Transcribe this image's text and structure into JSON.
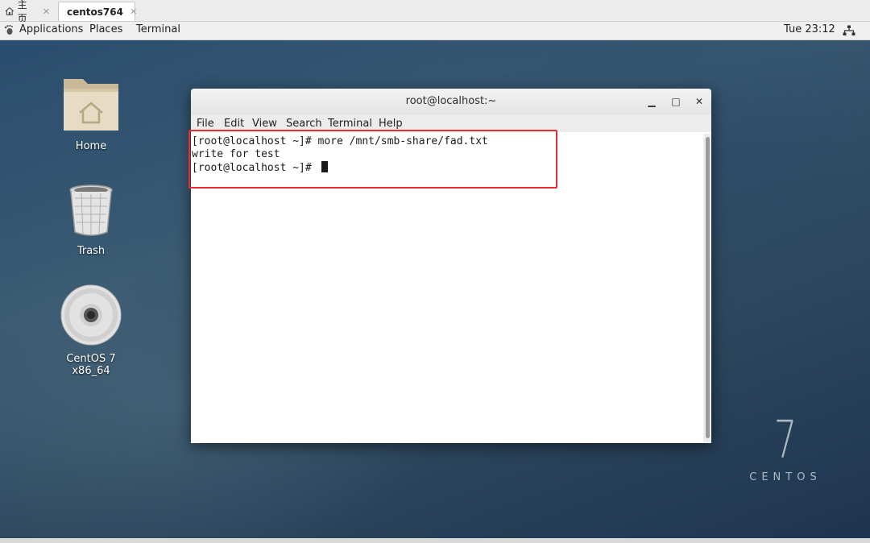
{
  "host_tabs": [
    {
      "label": "主页",
      "icon": "home-icon"
    },
    {
      "label": "centos764",
      "icon": "vm-icon"
    }
  ],
  "topbar": {
    "applications": "Applications",
    "places": "Places",
    "terminal": "Terminal",
    "clock": "Tue 23:12",
    "network_icon": "network-icon"
  },
  "desktop": {
    "icons": [
      {
        "label": "Home",
        "icon": "home-folder-icon"
      },
      {
        "label": "Trash",
        "icon": "trash-icon"
      },
      {
        "label": "CentOS 7 x86_64",
        "icon": "disc-icon"
      }
    ],
    "brand_numeral": "7",
    "brand_word": "CENTOS"
  },
  "terminal_window": {
    "title": "root@localhost:~",
    "menu": [
      "File",
      "Edit",
      "View",
      "Search",
      "Terminal",
      "Help"
    ],
    "lines": [
      "[root@localhost ~]# more /mnt/smb-share/fad.txt",
      "write for test",
      "[root@localhost ~]# "
    ]
  },
  "colors": {
    "highlight_box": "#e03030",
    "desktop_bg": "#2b4d6e"
  }
}
